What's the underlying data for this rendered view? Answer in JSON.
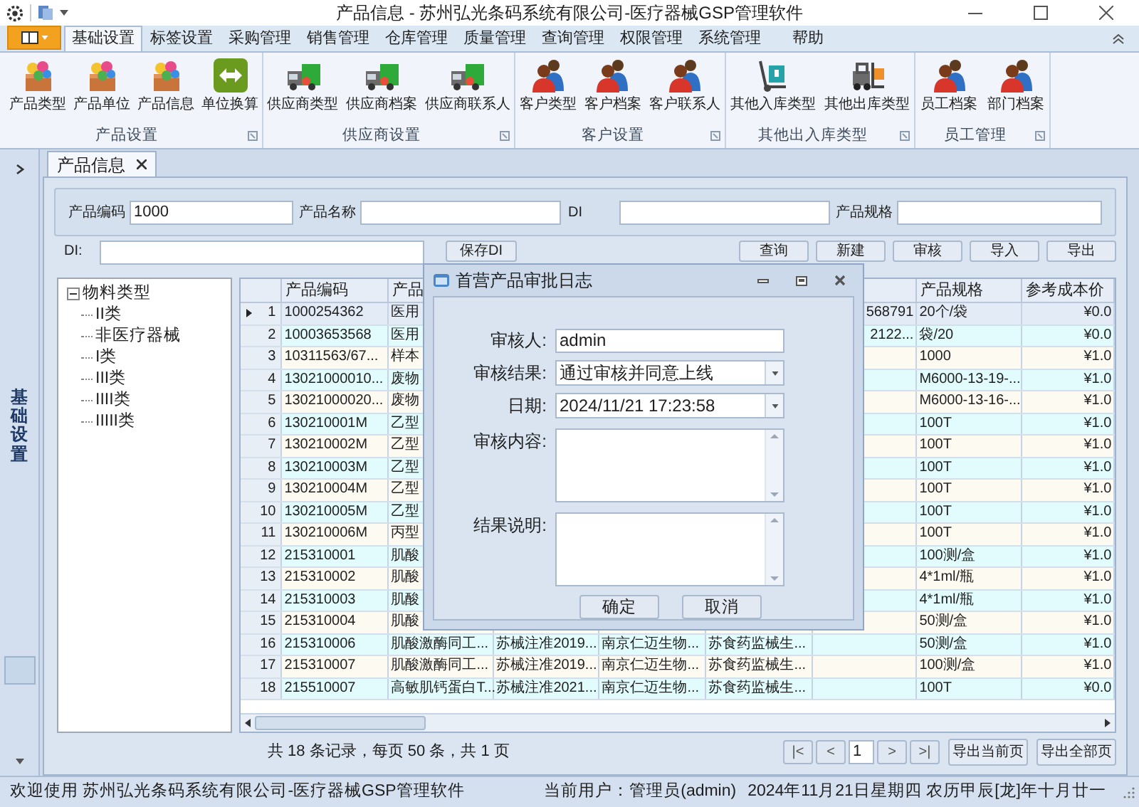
{
  "window": {
    "title": "产品信息 - 苏州弘光条码系统有限公司-医疗器械GSP管理软件"
  },
  "ribbon": {
    "tabs": [
      {
        "label": "基础设置",
        "selected": true
      },
      {
        "label": "标签设置",
        "selected": false
      },
      {
        "label": "采购管理",
        "selected": false
      },
      {
        "label": "销售管理",
        "selected": false
      },
      {
        "label": "仓库管理",
        "selected": false
      },
      {
        "label": "质量管理",
        "selected": false
      },
      {
        "label": "查询管理",
        "selected": false
      },
      {
        "label": "权限管理",
        "selected": false
      },
      {
        "label": "系统管理",
        "selected": false
      },
      {
        "label": "帮助",
        "selected": false
      }
    ],
    "groups": [
      {
        "label": "产品设置",
        "buttons": [
          {
            "label": "产品类型",
            "kind": "crate"
          },
          {
            "label": "产品单位",
            "kind": "crate"
          },
          {
            "label": "产品信息",
            "kind": "crate"
          },
          {
            "label": "单位换算",
            "kind": "swap"
          }
        ]
      },
      {
        "label": "供应商设置",
        "buttons": [
          {
            "label": "供应商类型",
            "kind": "truck"
          },
          {
            "label": "供应商档案",
            "kind": "truck"
          },
          {
            "label": "供应商联系人",
            "kind": "truck"
          }
        ]
      },
      {
        "label": "客户设置",
        "buttons": [
          {
            "label": "客户类型",
            "kind": "people"
          },
          {
            "label": "客户档案",
            "kind": "people"
          },
          {
            "label": "客户联系人",
            "kind": "people"
          }
        ]
      },
      {
        "label": "其他出入库类型",
        "buttons": [
          {
            "label": "其他入库类型",
            "kind": "dolly"
          },
          {
            "label": "其他出库类型",
            "kind": "forklift"
          }
        ]
      },
      {
        "label": "员工管理",
        "buttons": [
          {
            "label": "员工档案",
            "kind": "people"
          },
          {
            "label": "部门档案",
            "kind": "people"
          }
        ]
      }
    ]
  },
  "side_panel": {
    "label": "基础设置"
  },
  "document_tab": {
    "label": "产品信息"
  },
  "search": {
    "fields": [
      {
        "label": "产品编码",
        "value": "1000"
      },
      {
        "label": "产品名称"
      },
      {
        "label": "DI"
      },
      {
        "label": "产品规格"
      }
    ]
  },
  "toolbar": {
    "di_label": "DI:",
    "save_button": "保存DI",
    "buttons": [
      "查询",
      "新建",
      "审核",
      "导入",
      "导出"
    ]
  },
  "tree": {
    "label": "物料类型",
    "expanded": true,
    "children": [
      {
        "label": "II类"
      },
      {
        "label": "非医疗器械"
      },
      {
        "label": "I类"
      },
      {
        "label": "III类"
      },
      {
        "label": "IIII类"
      },
      {
        "label": "IIIII类"
      }
    ]
  },
  "table": {
    "header": {
      "code": "产品编码",
      "name": "产品",
      "spec": "产品规格",
      "price": "参考成本价"
    },
    "rows": [
      {
        "number": "1",
        "selected": true,
        "code": "1000254362",
        "name": "医用",
        "column_6": "568791",
        "spec": "20个/袋",
        "price": "¥0.0"
      },
      {
        "number": "2",
        "selected": false,
        "code": "10003653568",
        "name": "医用",
        "column_6": "2122...",
        "spec": "袋/20",
        "price": "¥0.0"
      },
      {
        "number": "3",
        "selected": false,
        "code": "10311563/67...",
        "name": "样本",
        "spec": "1000",
        "price": "¥1.0"
      },
      {
        "number": "4",
        "selected": false,
        "code": "13021000010...",
        "name": "废物",
        "spec": "M6000-13-19-...",
        "price": "¥1.0"
      },
      {
        "number": "5",
        "selected": false,
        "code": "13021000020...",
        "name": "废物",
        "spec": "M6000-13-16-...",
        "price": "¥1.0"
      },
      {
        "number": "6",
        "selected": false,
        "code": "130210001M",
        "name": "乙型",
        "spec": "100T",
        "price": "¥1.0"
      },
      {
        "number": "7",
        "selected": false,
        "code": "130210002M",
        "name": "乙型",
        "spec": "100T",
        "price": "¥1.0"
      },
      {
        "number": "8",
        "selected": false,
        "code": "130210003M",
        "name": "乙型",
        "spec": "100T",
        "price": "¥1.0"
      },
      {
        "number": "9",
        "selected": false,
        "code": "130210004M",
        "name": "乙型",
        "spec": "100T",
        "price": "¥1.0"
      },
      {
        "number": "10",
        "selected": false,
        "code": "130210005M",
        "name": "乙型",
        "spec": "100T",
        "price": "¥1.0"
      },
      {
        "number": "11",
        "selected": false,
        "code": "130210006M",
        "name": "丙型",
        "spec": "100T",
        "price": "¥1.0"
      },
      {
        "number": "12",
        "selected": false,
        "code": "215310001",
        "name": "肌酸",
        "spec": "100测/盒",
        "price": "¥1.0"
      },
      {
        "number": "13",
        "selected": false,
        "code": "215310002",
        "name": "肌酸",
        "spec": "4*1ml/瓶",
        "price": "¥1.0"
      },
      {
        "number": "14",
        "selected": false,
        "code": "215310003",
        "name": "肌酸",
        "spec": "4*1ml/瓶",
        "price": "¥1.0"
      },
      {
        "number": "15",
        "selected": false,
        "code": "215310004",
        "name": "肌酸",
        "spec": "50测/盒",
        "price": "¥1.0"
      },
      {
        "number": "16",
        "selected": false,
        "code": "215310006",
        "name": "肌酸激酶同工...",
        "column_3": "苏械注准2019...",
        "column_4": "南京仁迈生物...",
        "column_5": "苏食药监械生...",
        "spec": "50测/盒",
        "price": "¥1.0"
      },
      {
        "number": "17",
        "selected": false,
        "code": "215310007",
        "name": "肌酸激酶同工...",
        "column_3": "苏械注准2019...",
        "column_4": "南京仁迈生物...",
        "column_5": "苏食药监械生...",
        "spec": "100测/盒",
        "price": "¥1.0"
      },
      {
        "number": "18",
        "selected": false,
        "code": "215510007",
        "name": "高敏肌钙蛋白T...",
        "column_3": "苏械注准2021...",
        "column_4": "南京仁迈生物...",
        "column_5": "苏食药监械生...",
        "spec": "100T",
        "price": "¥0.0"
      }
    ]
  },
  "pager": {
    "summary": "共 18 条记录，每页 50 条，共 1 页",
    "first": "|<",
    "prev": "<",
    "page": "1",
    "next": ">",
    "last": ">|",
    "export_buttons": [
      "导出当前页",
      "导出全部页"
    ]
  },
  "dialog": {
    "title": "首营产品审批日志",
    "fields": [
      {
        "kind": "text",
        "label": "审核人:",
        "value": "admin"
      },
      {
        "kind": "combo",
        "label": "审核结果:",
        "value": "通过审核并同意上线"
      },
      {
        "kind": "combo",
        "label": "日期:",
        "value": "2024/11/21 17:23:58"
      },
      {
        "kind": "memo",
        "label": "审核内容:"
      },
      {
        "kind": "memo",
        "label": "结果说明:"
      }
    ],
    "buttons": [
      "确定",
      "取消"
    ]
  },
  "status_bar": {
    "left": "欢迎使用 苏州弘光条码系统有限公司-医疗器械GSP管理软件",
    "user": "当前用户：管理员(admin)",
    "date": "2024年11月21日星期四 农历甲辰[龙]年十月廿一"
  }
}
